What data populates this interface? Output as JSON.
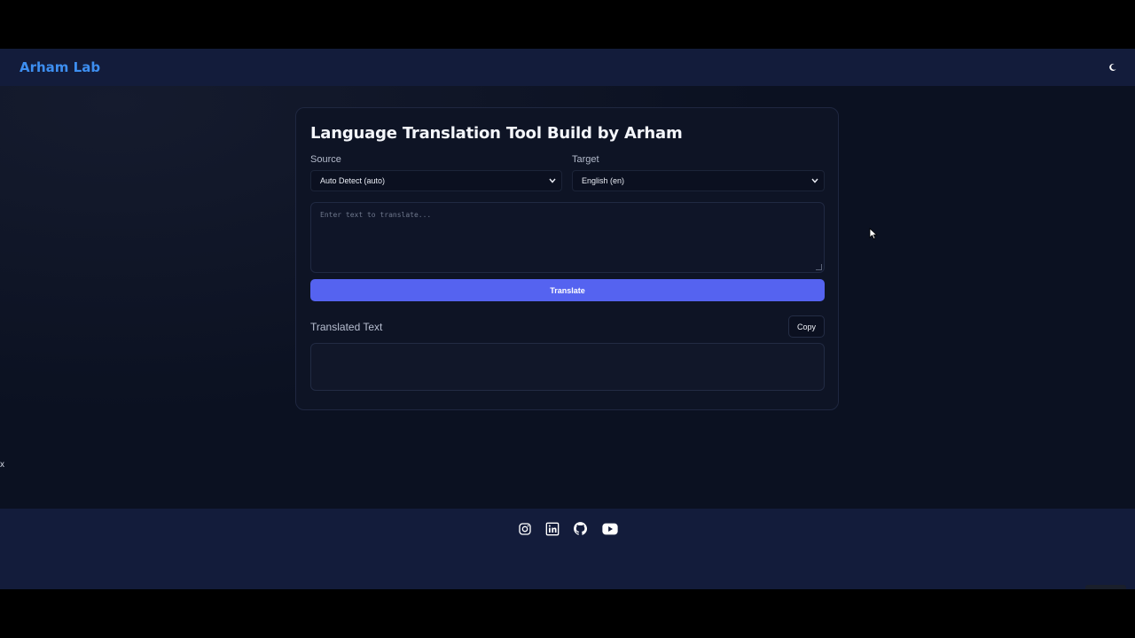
{
  "header": {
    "brand": "Arham Lab",
    "theme_toggle_icon": "moon-icon"
  },
  "translator": {
    "title": "Language Translation Tool Build by Arham",
    "source": {
      "label": "Source",
      "selected": "Auto Detect (auto)"
    },
    "target": {
      "label": "Target",
      "selected": "English (en)"
    },
    "input": {
      "placeholder": "Enter text to translate...",
      "value": ""
    },
    "translate_label": "Translate",
    "output_label": "Translated Text",
    "copy_label": "Copy",
    "output_value": ""
  },
  "stray_text": "x",
  "footer": {
    "social_icons": [
      "instagram-icon",
      "linkedin-icon",
      "github-icon",
      "youtube-icon"
    ]
  },
  "colors": {
    "page_bg": "#0b1121",
    "nav_bg": "#131c3b",
    "brand": "#3d8ef0",
    "accent": "#5563f0",
    "card_bg": "#0e1425"
  }
}
